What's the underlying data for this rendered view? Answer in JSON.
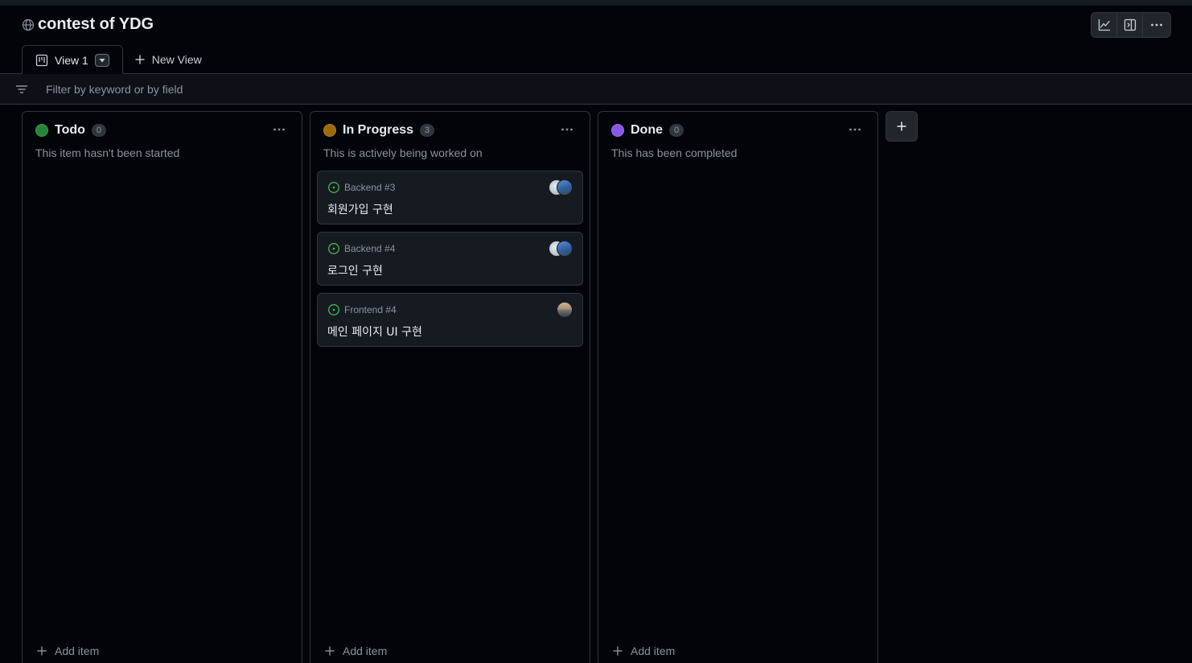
{
  "project": {
    "title": "contest of YDG"
  },
  "tabs": {
    "active_label": "View 1",
    "new_view_label": "New View"
  },
  "filter": {
    "placeholder": "Filter by keyword or by field",
    "value": ""
  },
  "colors": {
    "accent_green": "#238636",
    "accent_orange": "#9e6a03",
    "accent_purple": "#8957e5",
    "issue_open": "#3fb950"
  },
  "columns": [
    {
      "name": "Todo",
      "count": "0",
      "description": "This item hasn't been started",
      "dot_color": "#238636",
      "add_item_label": "Add item"
    },
    {
      "name": "In Progress",
      "count": "3",
      "description": "This is actively being worked on",
      "dot_color": "#9e6a03",
      "add_item_label": "Add item",
      "cards": [
        {
          "ref": "Backend #3",
          "title": "회원가입 구현"
        },
        {
          "ref": "Backend #4",
          "title": "로그인 구현"
        },
        {
          "ref": "Frontend #4",
          "title": "메인 페이지 UI 구현"
        }
      ]
    },
    {
      "name": "Done",
      "count": "0",
      "description": "This has been completed",
      "dot_color": "#8957e5",
      "add_item_label": "Add item"
    }
  ],
  "icons": {
    "visibility": "globe-icon",
    "insights": "graph-icon",
    "side_panel": "sidebar-icon",
    "more": "kebab-horizontal-icon",
    "board_layout": "project-board-icon",
    "filter": "filter-icon",
    "issue": "issue-opened-icon"
  }
}
